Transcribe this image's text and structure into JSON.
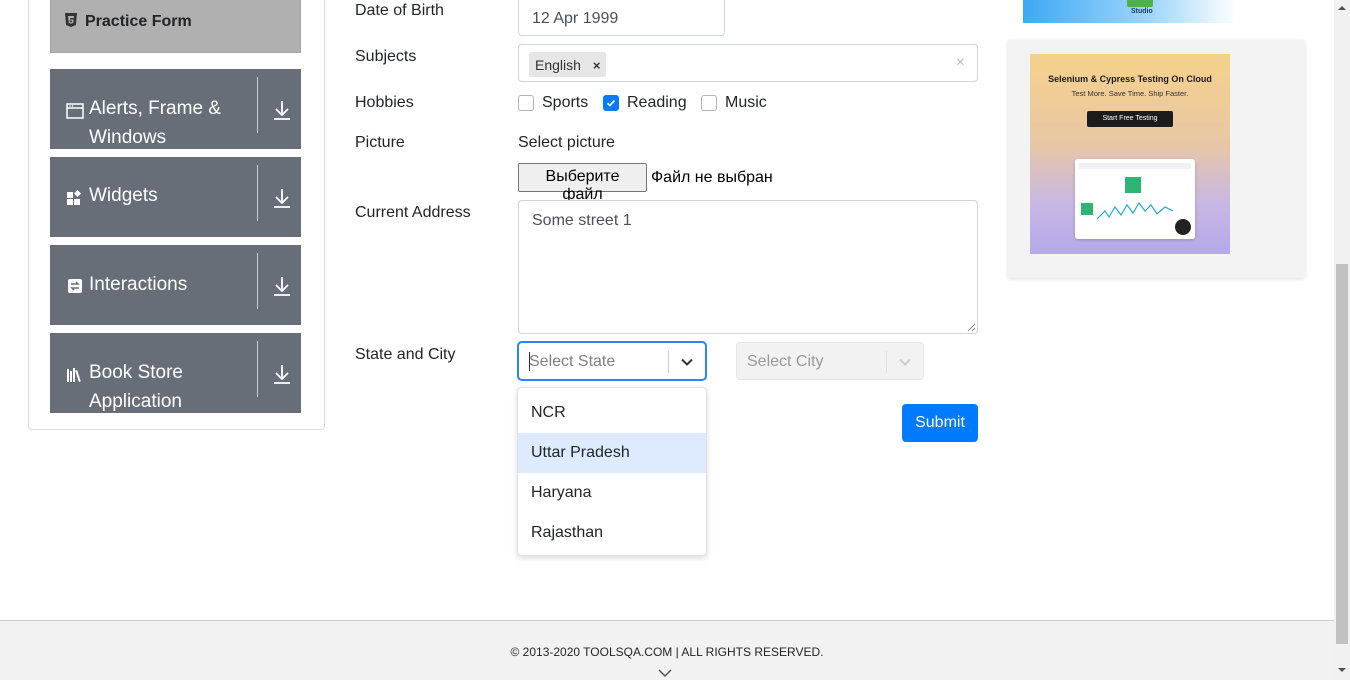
{
  "sidebar": {
    "active_item": "Practice Form",
    "groups": [
      {
        "label": "Alerts, Frame & Windows",
        "icon": "window-icon"
      },
      {
        "label": "Widgets",
        "icon": "widgets-icon"
      },
      {
        "label": "Interactions",
        "icon": "interactions-icon"
      },
      {
        "label": "Book Store Application",
        "icon": "books-icon"
      }
    ]
  },
  "form": {
    "dob_label": "Date of Birth",
    "dob_value": "12 Apr 1999",
    "subjects_label": "Subjects",
    "subject_chips": [
      "English"
    ],
    "chip_remove": "×",
    "subjects_clear": "×",
    "hobbies_label": "Hobbies",
    "hobbies": [
      {
        "label": "Sports",
        "checked": false
      },
      {
        "label": "Reading",
        "checked": true
      },
      {
        "label": "Music",
        "checked": false
      }
    ],
    "picture_label": "Picture",
    "picture_prompt": "Select picture",
    "file_button": "Выберите файл",
    "file_status": "Файл не выбран",
    "address_label": "Current Address",
    "address_value": "Some street 1",
    "state_city_label": "State and City",
    "state_placeholder": "Select State",
    "city_placeholder": "Select City",
    "state_options": [
      "NCR",
      "Uttar Pradesh",
      "Haryana",
      "Rajasthan"
    ],
    "highlighted_option": "Uttar Pradesh",
    "submit_label": "Submit"
  },
  "ads": {
    "top_banner_text": "Studio",
    "card_title": "Selenium & Cypress Testing On Cloud",
    "card_subtitle": "Test More. Save Time. Ship Faster.",
    "card_button": "Start Free Testing"
  },
  "footer": {
    "copyright": "© 2013-2020 TOOLSQA.COM | ALL RIGHTS RESERVED."
  },
  "colors": {
    "primary": "#007bff",
    "sidebar_group": "#686e78",
    "sidebar_active": "#b0b0b0",
    "option_highlight": "#deebff",
    "focus_border": "#2684ff"
  }
}
